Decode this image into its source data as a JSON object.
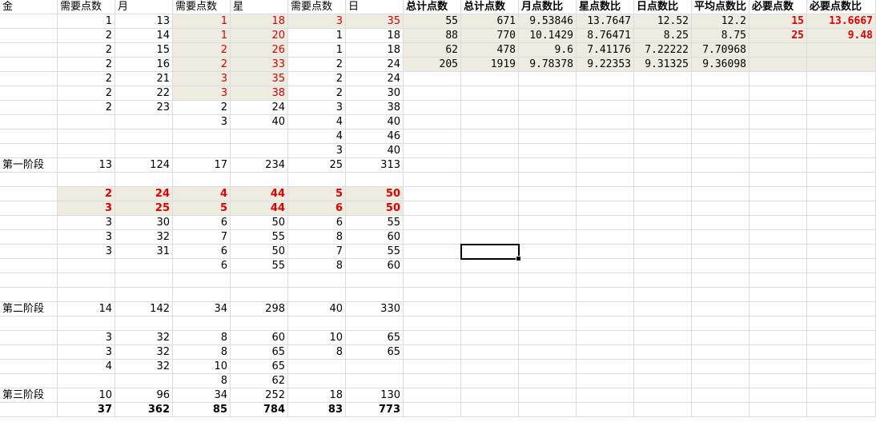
{
  "sheet": {
    "rows": [
      [
        {
          "text": "金",
          "align": "left"
        },
        {
          "text": "需要点数",
          "align": "left"
        },
        {
          "text": "月",
          "align": "left"
        },
        {
          "text": "需要点数",
          "align": "left"
        },
        {
          "text": "星",
          "align": "left"
        },
        {
          "text": "需要点数",
          "align": "left"
        },
        {
          "text": "日",
          "align": "left"
        },
        {
          "text": "总计点数",
          "align": "left",
          "bold": true
        },
        {
          "text": "总计点数",
          "align": "left",
          "bold": true
        },
        {
          "text": "月点数比",
          "align": "left",
          "bold": true
        },
        {
          "text": "星点数比",
          "align": "left",
          "bold": true
        },
        {
          "text": "日点数比",
          "align": "left",
          "bold": true
        },
        {
          "text": "平均点数比",
          "align": "left",
          "bold": true
        },
        {
          "text": "必要点数",
          "align": "left",
          "bold": true
        },
        {
          "text": "必要点数比",
          "align": "left",
          "bold": true
        }
      ],
      [
        {
          "text": ""
        },
        {
          "text": "1"
        },
        {
          "text": "13"
        },
        {
          "text": "1",
          "red": true,
          "hl": true
        },
        {
          "text": "18",
          "red": true,
          "hl": true
        },
        {
          "text": "3",
          "red": true,
          "hl": true
        },
        {
          "text": "35",
          "red": true,
          "hl": true
        },
        {
          "text": "55",
          "hl": true,
          "mono": true
        },
        {
          "text": "671",
          "hl": true,
          "mono": true
        },
        {
          "text": "9.53846",
          "hl": true,
          "mono": true
        },
        {
          "text": "13.7647",
          "hl": true,
          "mono": true
        },
        {
          "text": "12.52",
          "hl": true,
          "mono": true
        },
        {
          "text": "12.2",
          "hl": true,
          "mono": true
        },
        {
          "text": "15",
          "hl": true,
          "monob": true,
          "red": true
        },
        {
          "text": "13.6667",
          "hl": true,
          "monob": true,
          "red": true
        }
      ],
      [
        {
          "text": ""
        },
        {
          "text": "2"
        },
        {
          "text": "14"
        },
        {
          "text": "1",
          "red": true,
          "hl": true
        },
        {
          "text": "20",
          "red": true,
          "hl": true
        },
        {
          "text": "1"
        },
        {
          "text": "18"
        },
        {
          "text": "88",
          "hl": true,
          "mono": true
        },
        {
          "text": "770",
          "hl": true,
          "mono": true
        },
        {
          "text": "10.1429",
          "hl": true,
          "mono": true
        },
        {
          "text": "8.76471",
          "hl": true,
          "mono": true
        },
        {
          "text": "8.25",
          "hl": true,
          "mono": true
        },
        {
          "text": "8.75",
          "hl": true,
          "mono": true
        },
        {
          "text": "25",
          "hl": true,
          "monob": true,
          "red": true
        },
        {
          "text": "9.48",
          "hl": true,
          "monob": true,
          "red": true
        }
      ],
      [
        {
          "text": ""
        },
        {
          "text": "2"
        },
        {
          "text": "15"
        },
        {
          "text": "2",
          "red": true,
          "hl": true
        },
        {
          "text": "26",
          "red": true,
          "hl": true
        },
        {
          "text": "1"
        },
        {
          "text": "18"
        },
        {
          "text": "62",
          "hl": true,
          "mono": true
        },
        {
          "text": "478",
          "hl": true,
          "mono": true
        },
        {
          "text": "9.6",
          "hl": true,
          "mono": true
        },
        {
          "text": "7.41176",
          "hl": true,
          "mono": true
        },
        {
          "text": "7.22222",
          "hl": true,
          "mono": true
        },
        {
          "text": "7.70968",
          "hl": true,
          "mono": true
        },
        {
          "text": "",
          "hl": true
        },
        {
          "text": "",
          "hl": true
        }
      ],
      [
        {
          "text": ""
        },
        {
          "text": "2"
        },
        {
          "text": "16"
        },
        {
          "text": "2",
          "red": true,
          "hl": true
        },
        {
          "text": "33",
          "red": true,
          "hl": true
        },
        {
          "text": "2"
        },
        {
          "text": "24"
        },
        {
          "text": "205",
          "hl": true,
          "mono": true
        },
        {
          "text": "1919",
          "hl": true,
          "mono": true
        },
        {
          "text": "9.78378",
          "hl": true,
          "mono": true
        },
        {
          "text": "9.22353",
          "hl": true,
          "mono": true
        },
        {
          "text": "9.31325",
          "hl": true,
          "mono": true
        },
        {
          "text": "9.36098",
          "hl": true,
          "mono": true
        },
        {
          "text": "",
          "hl": true
        },
        {
          "text": "",
          "hl": true
        }
      ],
      [
        {
          "text": ""
        },
        {
          "text": "2"
        },
        {
          "text": "21"
        },
        {
          "text": "3",
          "red": true,
          "hl": true
        },
        {
          "text": "35",
          "red": true,
          "hl": true
        },
        {
          "text": "2"
        },
        {
          "text": "24"
        }
      ],
      [
        {
          "text": ""
        },
        {
          "text": "2"
        },
        {
          "text": "22"
        },
        {
          "text": "3",
          "red": true,
          "hl": true
        },
        {
          "text": "38",
          "red": true,
          "hl": true
        },
        {
          "text": "2"
        },
        {
          "text": "30"
        }
      ],
      [
        {
          "text": ""
        },
        {
          "text": "2"
        },
        {
          "text": "23"
        },
        {
          "text": "2"
        },
        {
          "text": "24"
        },
        {
          "text": "3"
        },
        {
          "text": "38"
        }
      ],
      [
        {
          "text": ""
        },
        {
          "text": ""
        },
        {
          "text": ""
        },
        {
          "text": "3"
        },
        {
          "text": "40"
        },
        {
          "text": "4"
        },
        {
          "text": "40"
        }
      ],
      [
        {
          "text": ""
        },
        {
          "text": ""
        },
        {
          "text": ""
        },
        {
          "text": ""
        },
        {
          "text": ""
        },
        {
          "text": "4"
        },
        {
          "text": "46"
        }
      ],
      [
        {
          "text": ""
        },
        {
          "text": ""
        },
        {
          "text": ""
        },
        {
          "text": ""
        },
        {
          "text": ""
        },
        {
          "text": "3"
        },
        {
          "text": "40"
        }
      ],
      [
        {
          "text": "第一阶段",
          "align": "left"
        },
        {
          "text": "13"
        },
        {
          "text": "124"
        },
        {
          "text": "17"
        },
        {
          "text": "234"
        },
        {
          "text": "25"
        },
        {
          "text": "313"
        }
      ],
      [],
      [
        {
          "text": ""
        },
        {
          "text": "2",
          "red": true,
          "hl": true,
          "bold": true
        },
        {
          "text": "24",
          "red": true,
          "hl": true,
          "bold": true
        },
        {
          "text": "4",
          "red": true,
          "hl": true,
          "bold": true
        },
        {
          "text": "44",
          "red": true,
          "hl": true,
          "bold": true
        },
        {
          "text": "5",
          "red": true,
          "hl": true,
          "bold": true
        },
        {
          "text": "50",
          "red": true,
          "hl": true,
          "bold": true
        }
      ],
      [
        {
          "text": ""
        },
        {
          "text": "3",
          "red": true,
          "hl": true,
          "bold": true
        },
        {
          "text": "25",
          "red": true,
          "hl": true,
          "bold": true
        },
        {
          "text": "5",
          "red": true,
          "hl": true,
          "bold": true
        },
        {
          "text": "44",
          "red": true,
          "hl": true,
          "bold": true
        },
        {
          "text": "6",
          "red": true,
          "hl": true,
          "bold": true
        },
        {
          "text": "50",
          "red": true,
          "hl": true,
          "bold": true
        }
      ],
      [
        {
          "text": ""
        },
        {
          "text": "3"
        },
        {
          "text": "30"
        },
        {
          "text": "6"
        },
        {
          "text": "50"
        },
        {
          "text": "6"
        },
        {
          "text": "55"
        }
      ],
      [
        {
          "text": ""
        },
        {
          "text": "3"
        },
        {
          "text": "32"
        },
        {
          "text": "7"
        },
        {
          "text": "55"
        },
        {
          "text": "8"
        },
        {
          "text": "60"
        }
      ],
      [
        {
          "text": ""
        },
        {
          "text": "3"
        },
        {
          "text": "31"
        },
        {
          "text": "6"
        },
        {
          "text": "50"
        },
        {
          "text": "7"
        },
        {
          "text": "55"
        }
      ],
      [
        {
          "text": ""
        },
        {
          "text": ""
        },
        {
          "text": ""
        },
        {
          "text": "6"
        },
        {
          "text": "55"
        },
        {
          "text": "8"
        },
        {
          "text": "60"
        }
      ],
      [],
      [],
      [
        {
          "text": "第二阶段",
          "align": "left"
        },
        {
          "text": "14"
        },
        {
          "text": "142"
        },
        {
          "text": "34"
        },
        {
          "text": "298"
        },
        {
          "text": "40"
        },
        {
          "text": "330"
        }
      ],
      [],
      [
        {
          "text": ""
        },
        {
          "text": "3"
        },
        {
          "text": "32"
        },
        {
          "text": "8"
        },
        {
          "text": "60"
        },
        {
          "text": "10"
        },
        {
          "text": "65"
        }
      ],
      [
        {
          "text": ""
        },
        {
          "text": "3"
        },
        {
          "text": "32"
        },
        {
          "text": "8"
        },
        {
          "text": "65"
        },
        {
          "text": "8"
        },
        {
          "text": "65"
        }
      ],
      [
        {
          "text": ""
        },
        {
          "text": "4"
        },
        {
          "text": "32"
        },
        {
          "text": "10"
        },
        {
          "text": "65"
        },
        {
          "text": ""
        },
        {
          "text": ""
        }
      ],
      [
        {
          "text": ""
        },
        {
          "text": ""
        },
        {
          "text": ""
        },
        {
          "text": "8"
        },
        {
          "text": "62"
        },
        {
          "text": ""
        },
        {
          "text": ""
        }
      ],
      [
        {
          "text": "第三阶段",
          "align": "left"
        },
        {
          "text": "10"
        },
        {
          "text": "96"
        },
        {
          "text": "34"
        },
        {
          "text": "252"
        },
        {
          "text": "18"
        },
        {
          "text": "130"
        }
      ],
      [
        {
          "text": ""
        },
        {
          "text": "37",
          "bold": true
        },
        {
          "text": "362",
          "bold": true
        },
        {
          "text": "85",
          "bold": true
        },
        {
          "text": "784",
          "bold": true
        },
        {
          "text": "83",
          "bold": true
        },
        {
          "text": "773",
          "bold": true
        }
      ]
    ]
  },
  "selection": {
    "column": 8,
    "row": 17
  },
  "colors": {
    "highlight": "#eeece1",
    "red_text": "#e00000",
    "grid": "#dadcdd"
  }
}
